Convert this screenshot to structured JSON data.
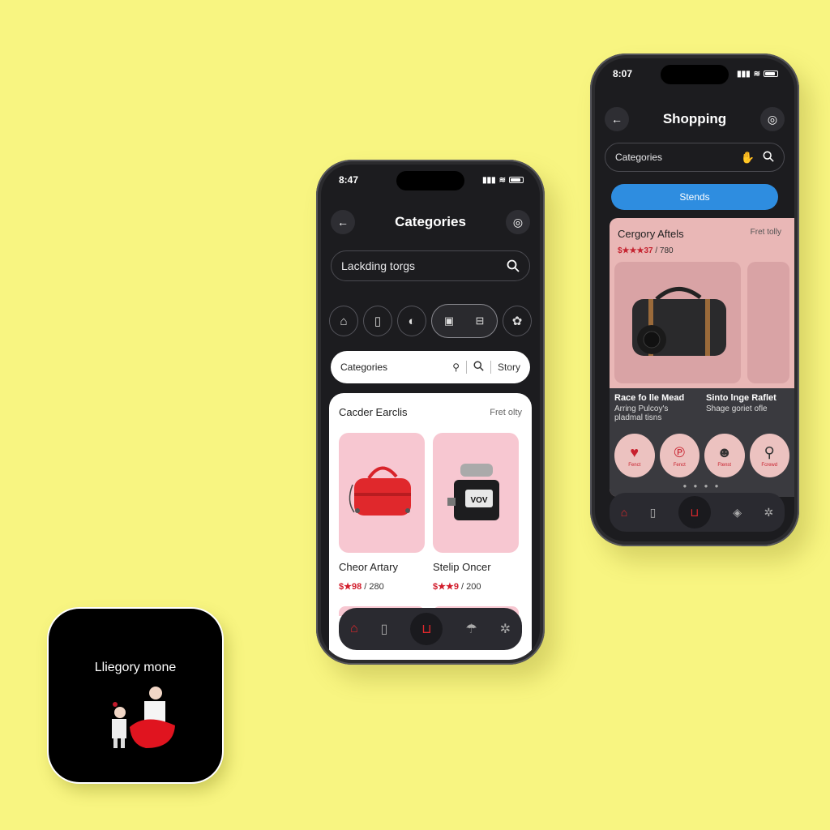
{
  "phone1": {
    "time": "8:47",
    "title": "Categories",
    "search_text": "Lackding torgs",
    "white_search": {
      "label": "Categories",
      "right": "Story"
    },
    "card_title": "Cacder Earclis",
    "card_sub": "Fret olty",
    "products": [
      {
        "name": "Cheor Artary",
        "price_red": "$★98",
        "price_rest": " / 280"
      },
      {
        "name": "Stelip Oncer",
        "price_red": "$★★9",
        "price_rest": " / 200"
      }
    ],
    "tab_icons": [
      "home-icon",
      "tablet-icon",
      "basket-icon",
      "umbrella-icon",
      "puzzle-icon"
    ]
  },
  "phone2": {
    "time": "8:07",
    "title": "Shopping",
    "search_text": "Categories",
    "blue_button": "Stends",
    "panel_title": "Cergory Aftels",
    "panel_sub": "Fret tolly",
    "panel_price_red": "$★★★37",
    "panel_price_rest": " / 780",
    "info": [
      {
        "title": "Race fo lle Mead",
        "desc": "Arring Pulcoy's pladmal tisns"
      },
      {
        "title": "Sinto lnge Raflet",
        "desc": "Shage goriet ofle"
      }
    ],
    "circle_labels": [
      "Fenct",
      "Fenct",
      "Ftenst",
      "Fcrewd"
    ],
    "circle_icons": [
      "heart-icon",
      "pinterest-icon",
      "people-icon",
      "pin-icon"
    ]
  },
  "appicon": {
    "label": "Lliegory mone"
  },
  "colors": {
    "background": "#f8f581",
    "accent_red": "#d21d2c",
    "accent_blue": "#2e8de0",
    "card_pink": "#f7c7d1"
  }
}
